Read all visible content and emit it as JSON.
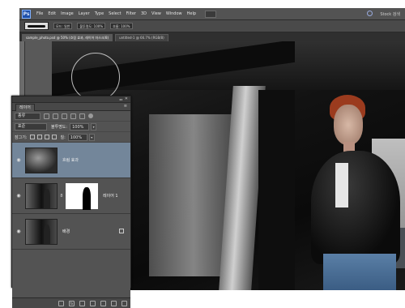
{
  "app": {
    "logo_text": "Ps",
    "search_label": "Stock 검색"
  },
  "menubar": {
    "items": [
      "File",
      "Edit",
      "Image",
      "Layer",
      "Type",
      "Select",
      "Filter",
      "3D",
      "View",
      "Window",
      "Help"
    ]
  },
  "options_bar": {
    "fields": [
      "모드: 일반",
      "불투명도: 100%",
      "흐름: 100%"
    ]
  },
  "tabs": [
    {
      "label": "sample_photo.psd @ 50% (흐림 효과, 레이어 마스크/8)",
      "active": true
    },
    {
      "label": "untitled-1 @ 66.7% (RGB/8)",
      "active": false
    }
  ],
  "layers_panel": {
    "collapse": "◂◂",
    "close": "✕",
    "tab_label": "레이어",
    "menu": "≡",
    "kind_label": "종류",
    "blend_mode": "표준",
    "opacity_label": "불투명도:",
    "opacity_value": "100%",
    "lock_label": "잠그기:",
    "fill_label": "칠:",
    "fill_value": "100%",
    "layers": [
      {
        "name": "흐림 효과",
        "visible": true,
        "selected": true
      },
      {
        "name": "레이어 1",
        "visible": true,
        "selected": false
      },
      {
        "name": "배경",
        "visible": true,
        "selected": false
      }
    ],
    "bottom_icons": [
      "link-icon",
      "fx-icon",
      "mask-icon",
      "adjustment-icon",
      "folder-icon",
      "new-layer-icon",
      "trash-icon"
    ]
  },
  "colors": {
    "selected_layer": "#73869a",
    "panel_bg": "#535353",
    "hair": "#9b3b1e",
    "jeans": "#4a6e95"
  }
}
